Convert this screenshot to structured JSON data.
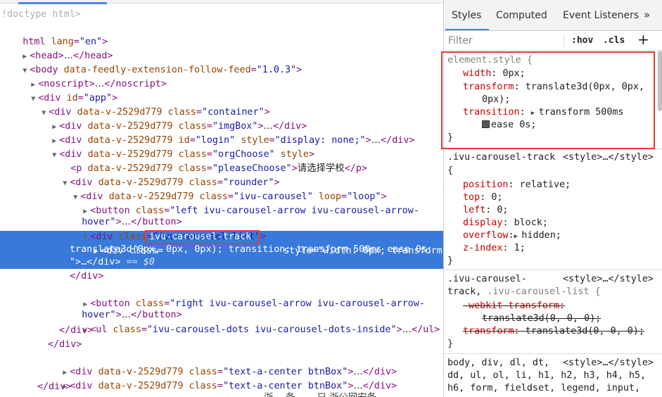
{
  "dom": {
    "lines": [
      {
        "text": "!doctype html>"
      },
      {
        "text": "html lang=\"en\">"
      },
      {
        "tri": "▶",
        "text": "<head>…</head>"
      },
      {
        "tri": "▼",
        "text": "<body data-feedly-extension-follow-feed=\"1.0.3\">"
      },
      {
        "tri": "▶",
        "text": "<noscript>…</noscript>"
      },
      {
        "tri": "▼",
        "text": "<div id=\"app\">"
      },
      {
        "tri": "▼",
        "text": "<div data-v-2529d779 class=\"container\">"
      },
      {
        "tri": "▶",
        "text": "<div data-v-2529d779 class=\"imgBox\">…</div>"
      },
      {
        "tri": "▶",
        "text": "<div data-v-2529d779 id=\"login\" style=\"display: none;\">…</div>"
      },
      {
        "tri": "▼",
        "text": "<div data-v-2529d779 class=\"orgChoose\" style>"
      },
      {
        "text": "<p data-v-2529d779 class=\"pleaseChoose\">请选择学校</p>"
      },
      {
        "tri": "▼",
        "text": "<div data-v-2529d779 class=\"rounder\">"
      },
      {
        "tri": "▼",
        "text": "<div data-v-2529d779 class=\"ivu-carousel\" loop=\"loop\">"
      },
      {
        "tri": "▶",
        "text": "<button class=\"left ivu-carousel-arrow ivu-carousel-arrow-"
      },
      {
        "text": "hover\">…</button>"
      },
      {
        "tri": "▼",
        "text": "<div class=\"ivu-carousel-list\">"
      },
      {
        "tri": "▶",
        "text": "<div class=\"ivu-carousel-track\" style=\"width: 0px; transform:"
      },
      {
        "text": "translate3d(0px, 0px, 0px); transition: transform 500ms ease 0s;"
      },
      {
        "text": "\">…</div> == $0"
      },
      {
        "text": "</div>"
      },
      {
        "tri": "▶",
        "text": "<button class=\"right ivu-carousel-arrow ivu-carousel-arrow-"
      },
      {
        "text": "hover\">…</button>"
      },
      {
        "tri": "▶",
        "text": "<ul class=\"ivu-carousel-dots ivu-carousel-dots-inside\">…</ul>"
      },
      {
        "text": "</div>"
      },
      {
        "text": "</div>"
      },
      {
        "tri": "▶",
        "text": "<div data-v-2529d779 class=\"text-a-center btnBox\">…</div>"
      },
      {
        "tri": "▶",
        "text": "<div data-v-2529d779 class=\"text-a-center btnBox\">…</div>"
      },
      {
        "text": "</div>"
      },
      {
        "text": "浙… 备… …只 浙公网安备"
      }
    ],
    "highlighted_class": "ivu-carousel-track"
  },
  "styles": {
    "tabs": [
      "Styles",
      "Computed",
      "Event Listeners"
    ],
    "more_icon": "»",
    "filter_placeholder": "Filter",
    "hov": ":hov",
    "cls": ".cls",
    "plus": "+",
    "element_style": {
      "selector": "element.style {",
      "props": [
        {
          "name": "width",
          "value": "0px;"
        },
        {
          "name": "transform",
          "value": "translate3d(0px, 0px,"
        },
        {
          "name": "",
          "value": "0px);"
        },
        {
          "name": "transition",
          "value": "transform 500ms"
        },
        {
          "name": "",
          "value": "ease 0s;"
        }
      ],
      "close": "}"
    },
    "rule1": {
      "selector": ".ivu-carousel-track",
      "source": "<style>…</style>",
      "open": "{",
      "props": [
        {
          "name": "position",
          "value": "relative;"
        },
        {
          "name": "top",
          "value": "0;"
        },
        {
          "name": "left",
          "value": "0;"
        },
        {
          "name": "display",
          "value": "block;"
        },
        {
          "name": "overflow",
          "value": "hidden;"
        },
        {
          "name": "z-index",
          "value": "1;"
        }
      ],
      "close": "}"
    },
    "rule2": {
      "selector_a": ".ivu-carousel-",
      "selector_b": "track,",
      "selector_c": ".ivu-carousel-list {",
      "source": "<style>…</style>",
      "props": [
        {
          "name": "-webkit-transform:",
          "value": ""
        },
        {
          "name": "",
          "value": "translate3d(0, 0, 0);"
        },
        {
          "name": "transform:",
          "value": "translate3d(0, 0, 0);"
        }
      ],
      "close": "}"
    },
    "rule3": {
      "line1": "body, div, dl, dt,",
      "source": "<style>…</style>",
      "line2": "dd, ul, ol, li, h1, h2, h3, h4, h5,",
      "line3": "h6, form, fieldset, legend, input,"
    }
  },
  "colors": {
    "selection": "#3879d9",
    "highlight_border": "#e53935",
    "prop_name": "#c80000",
    "tag": "#881280",
    "attr_name": "#994500",
    "attr_value": "#1a1aa6"
  }
}
